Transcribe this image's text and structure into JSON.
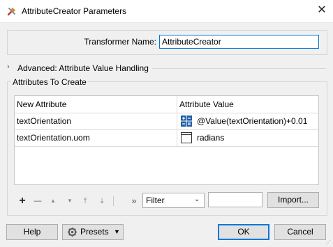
{
  "window": {
    "title": "AttributeCreator Parameters",
    "close_symbol": "✕",
    "icon": "wrench-tool-icon"
  },
  "transformer": {
    "label": "Transformer Name:",
    "value": "AttributeCreator"
  },
  "advanced": {
    "label": "Advanced: Attribute Value Handling",
    "icon": "chevron-right-icon"
  },
  "attributes_group": {
    "title": "Attributes To Create",
    "columns": [
      "New Attribute",
      "Attribute Value"
    ],
    "rows": [
      {
        "name": "textOrientation",
        "value": "@Value(textOrientation)+0.01",
        "icon": "arithmetic-editor-icon"
      },
      {
        "name": "textOrientation.uom",
        "value": "radians",
        "icon": "text-editor-icon"
      }
    ]
  },
  "toolbar": {
    "add": "+",
    "remove": "—",
    "move_up": "▲",
    "move_down": "▼",
    "move_top": "⤒",
    "move_bottom": "⤓",
    "expand": "»",
    "filter_selected": "Filter",
    "filter_placeholder": "",
    "import_label": "Import..."
  },
  "footer": {
    "help": "Help",
    "presets": "Presets",
    "ok": "OK",
    "cancel": "Cancel"
  },
  "colors": {
    "accent": "#0078d7",
    "dialog_bg": "#f0f0f0",
    "icon_blue": "#1f5fa8"
  }
}
